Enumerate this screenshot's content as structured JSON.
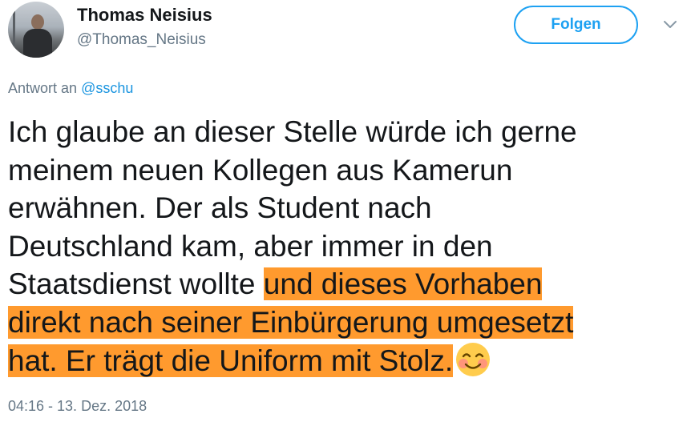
{
  "author": {
    "name": "Thomas Neisius",
    "handle": "@Thomas_Neisius"
  },
  "actions": {
    "follow_label": "Folgen",
    "more_icon": "chevron-down-icon"
  },
  "reply": {
    "prefix": "Antwort an",
    "mention": "@sschu"
  },
  "tweet": {
    "lines": [
      "Ich glaube an dieser Stelle würde ich gerne",
      "meinem neuen Kollegen aus Kamerun",
      "erwähnen.  Der als Student nach",
      "Deutschland kam, aber immer in den"
    ],
    "line5_plain": "Staatsdienst wollte ",
    "line5_highlight": "und dieses Vorhaben",
    "line6_highlight": "direkt nach seiner Einbürgerung umgesetzt",
    "line7_highlight": "hat. Er trägt die Uniform mit Stolz.",
    "emoji": "smiling-face-with-smiling-eyes",
    "highlight_color": "#ff9a2e"
  },
  "timestamp": "04:16 - 13. Dez. 2018",
  "colors": {
    "accent": "#1da1f2",
    "text": "#14171a",
    "secondary": "#657786"
  }
}
